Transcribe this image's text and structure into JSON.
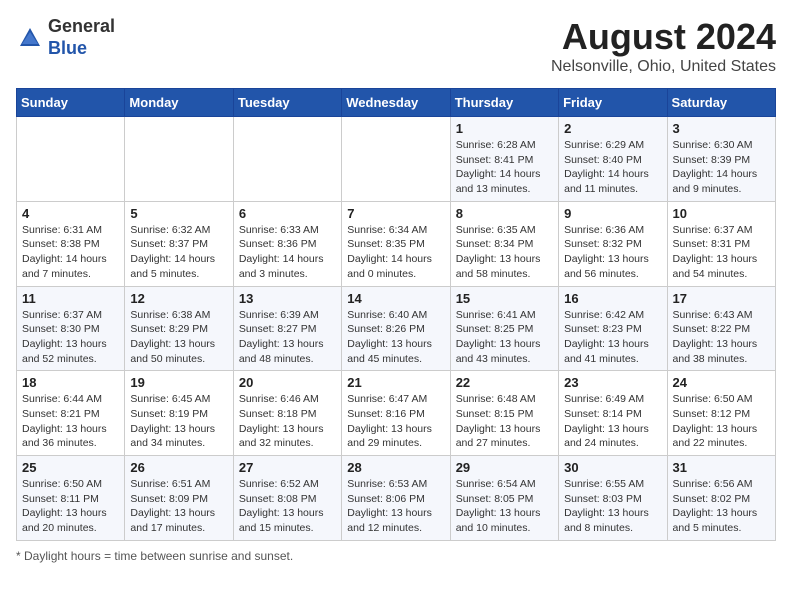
{
  "header": {
    "logo_general": "General",
    "logo_blue": "Blue",
    "month_title": "August 2024",
    "location": "Nelsonville, Ohio, United States"
  },
  "days_of_week": [
    "Sunday",
    "Monday",
    "Tuesday",
    "Wednesday",
    "Thursday",
    "Friday",
    "Saturday"
  ],
  "footer": {
    "note": "Daylight hours"
  },
  "weeks": [
    [
      {
        "day": "",
        "info": ""
      },
      {
        "day": "",
        "info": ""
      },
      {
        "day": "",
        "info": ""
      },
      {
        "day": "",
        "info": ""
      },
      {
        "day": "1",
        "info": "Sunrise: 6:28 AM\nSunset: 8:41 PM\nDaylight: 14 hours\nand 13 minutes."
      },
      {
        "day": "2",
        "info": "Sunrise: 6:29 AM\nSunset: 8:40 PM\nDaylight: 14 hours\nand 11 minutes."
      },
      {
        "day": "3",
        "info": "Sunrise: 6:30 AM\nSunset: 8:39 PM\nDaylight: 14 hours\nand 9 minutes."
      }
    ],
    [
      {
        "day": "4",
        "info": "Sunrise: 6:31 AM\nSunset: 8:38 PM\nDaylight: 14 hours\nand 7 minutes."
      },
      {
        "day": "5",
        "info": "Sunrise: 6:32 AM\nSunset: 8:37 PM\nDaylight: 14 hours\nand 5 minutes."
      },
      {
        "day": "6",
        "info": "Sunrise: 6:33 AM\nSunset: 8:36 PM\nDaylight: 14 hours\nand 3 minutes."
      },
      {
        "day": "7",
        "info": "Sunrise: 6:34 AM\nSunset: 8:35 PM\nDaylight: 14 hours\nand 0 minutes."
      },
      {
        "day": "8",
        "info": "Sunrise: 6:35 AM\nSunset: 8:34 PM\nDaylight: 13 hours\nand 58 minutes."
      },
      {
        "day": "9",
        "info": "Sunrise: 6:36 AM\nSunset: 8:32 PM\nDaylight: 13 hours\nand 56 minutes."
      },
      {
        "day": "10",
        "info": "Sunrise: 6:37 AM\nSunset: 8:31 PM\nDaylight: 13 hours\nand 54 minutes."
      }
    ],
    [
      {
        "day": "11",
        "info": "Sunrise: 6:37 AM\nSunset: 8:30 PM\nDaylight: 13 hours\nand 52 minutes."
      },
      {
        "day": "12",
        "info": "Sunrise: 6:38 AM\nSunset: 8:29 PM\nDaylight: 13 hours\nand 50 minutes."
      },
      {
        "day": "13",
        "info": "Sunrise: 6:39 AM\nSunset: 8:27 PM\nDaylight: 13 hours\nand 48 minutes."
      },
      {
        "day": "14",
        "info": "Sunrise: 6:40 AM\nSunset: 8:26 PM\nDaylight: 13 hours\nand 45 minutes."
      },
      {
        "day": "15",
        "info": "Sunrise: 6:41 AM\nSunset: 8:25 PM\nDaylight: 13 hours\nand 43 minutes."
      },
      {
        "day": "16",
        "info": "Sunrise: 6:42 AM\nSunset: 8:23 PM\nDaylight: 13 hours\nand 41 minutes."
      },
      {
        "day": "17",
        "info": "Sunrise: 6:43 AM\nSunset: 8:22 PM\nDaylight: 13 hours\nand 38 minutes."
      }
    ],
    [
      {
        "day": "18",
        "info": "Sunrise: 6:44 AM\nSunset: 8:21 PM\nDaylight: 13 hours\nand 36 minutes."
      },
      {
        "day": "19",
        "info": "Sunrise: 6:45 AM\nSunset: 8:19 PM\nDaylight: 13 hours\nand 34 minutes."
      },
      {
        "day": "20",
        "info": "Sunrise: 6:46 AM\nSunset: 8:18 PM\nDaylight: 13 hours\nand 32 minutes."
      },
      {
        "day": "21",
        "info": "Sunrise: 6:47 AM\nSunset: 8:16 PM\nDaylight: 13 hours\nand 29 minutes."
      },
      {
        "day": "22",
        "info": "Sunrise: 6:48 AM\nSunset: 8:15 PM\nDaylight: 13 hours\nand 27 minutes."
      },
      {
        "day": "23",
        "info": "Sunrise: 6:49 AM\nSunset: 8:14 PM\nDaylight: 13 hours\nand 24 minutes."
      },
      {
        "day": "24",
        "info": "Sunrise: 6:50 AM\nSunset: 8:12 PM\nDaylight: 13 hours\nand 22 minutes."
      }
    ],
    [
      {
        "day": "25",
        "info": "Sunrise: 6:50 AM\nSunset: 8:11 PM\nDaylight: 13 hours\nand 20 minutes."
      },
      {
        "day": "26",
        "info": "Sunrise: 6:51 AM\nSunset: 8:09 PM\nDaylight: 13 hours\nand 17 minutes."
      },
      {
        "day": "27",
        "info": "Sunrise: 6:52 AM\nSunset: 8:08 PM\nDaylight: 13 hours\nand 15 minutes."
      },
      {
        "day": "28",
        "info": "Sunrise: 6:53 AM\nSunset: 8:06 PM\nDaylight: 13 hours\nand 12 minutes."
      },
      {
        "day": "29",
        "info": "Sunrise: 6:54 AM\nSunset: 8:05 PM\nDaylight: 13 hours\nand 10 minutes."
      },
      {
        "day": "30",
        "info": "Sunrise: 6:55 AM\nSunset: 8:03 PM\nDaylight: 13 hours\nand 8 minutes."
      },
      {
        "day": "31",
        "info": "Sunrise: 6:56 AM\nSunset: 8:02 PM\nDaylight: 13 hours\nand 5 minutes."
      }
    ]
  ]
}
